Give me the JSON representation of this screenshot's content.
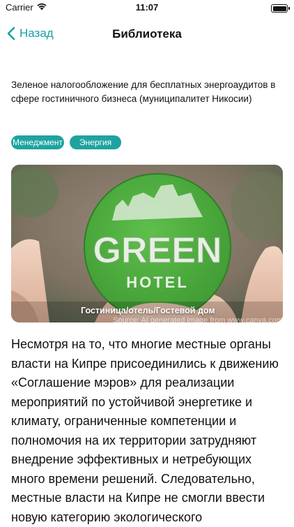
{
  "status_bar": {
    "carrier": "Carrier",
    "time": "11:07"
  },
  "nav": {
    "back_label": "Назад",
    "title": "Библиотека"
  },
  "article": {
    "headline": "Зеленое налогообложение для бесплатных энергоаудитов в сфере гостиничного бизнеса (муниципалитет Никосии)",
    "tags": [
      "Менеджмент",
      "Энергия"
    ],
    "image": {
      "badge_word_1": "GREEN",
      "badge_word_2": "HOTEL",
      "caption": "Гостиница/отель/Гостевой дом",
      "source": "Source: AI generated image from www.canva.com"
    },
    "body": "Несмотря на то, что многие местные органы власти на Кипре присоединились к движению «Соглашение мэров» для реализации мероприятий по устойчивой энергетике и климату, ограниченные компетенции и полномочия на их территории затрудняют внедрение эффективных и нетребующих много времени решений. Следовательно, местные власти на Кипре не смогли ввести новую категорию экологического"
  },
  "colors": {
    "accent": "#1ea3a0",
    "badge_green": "#4cae3c"
  }
}
